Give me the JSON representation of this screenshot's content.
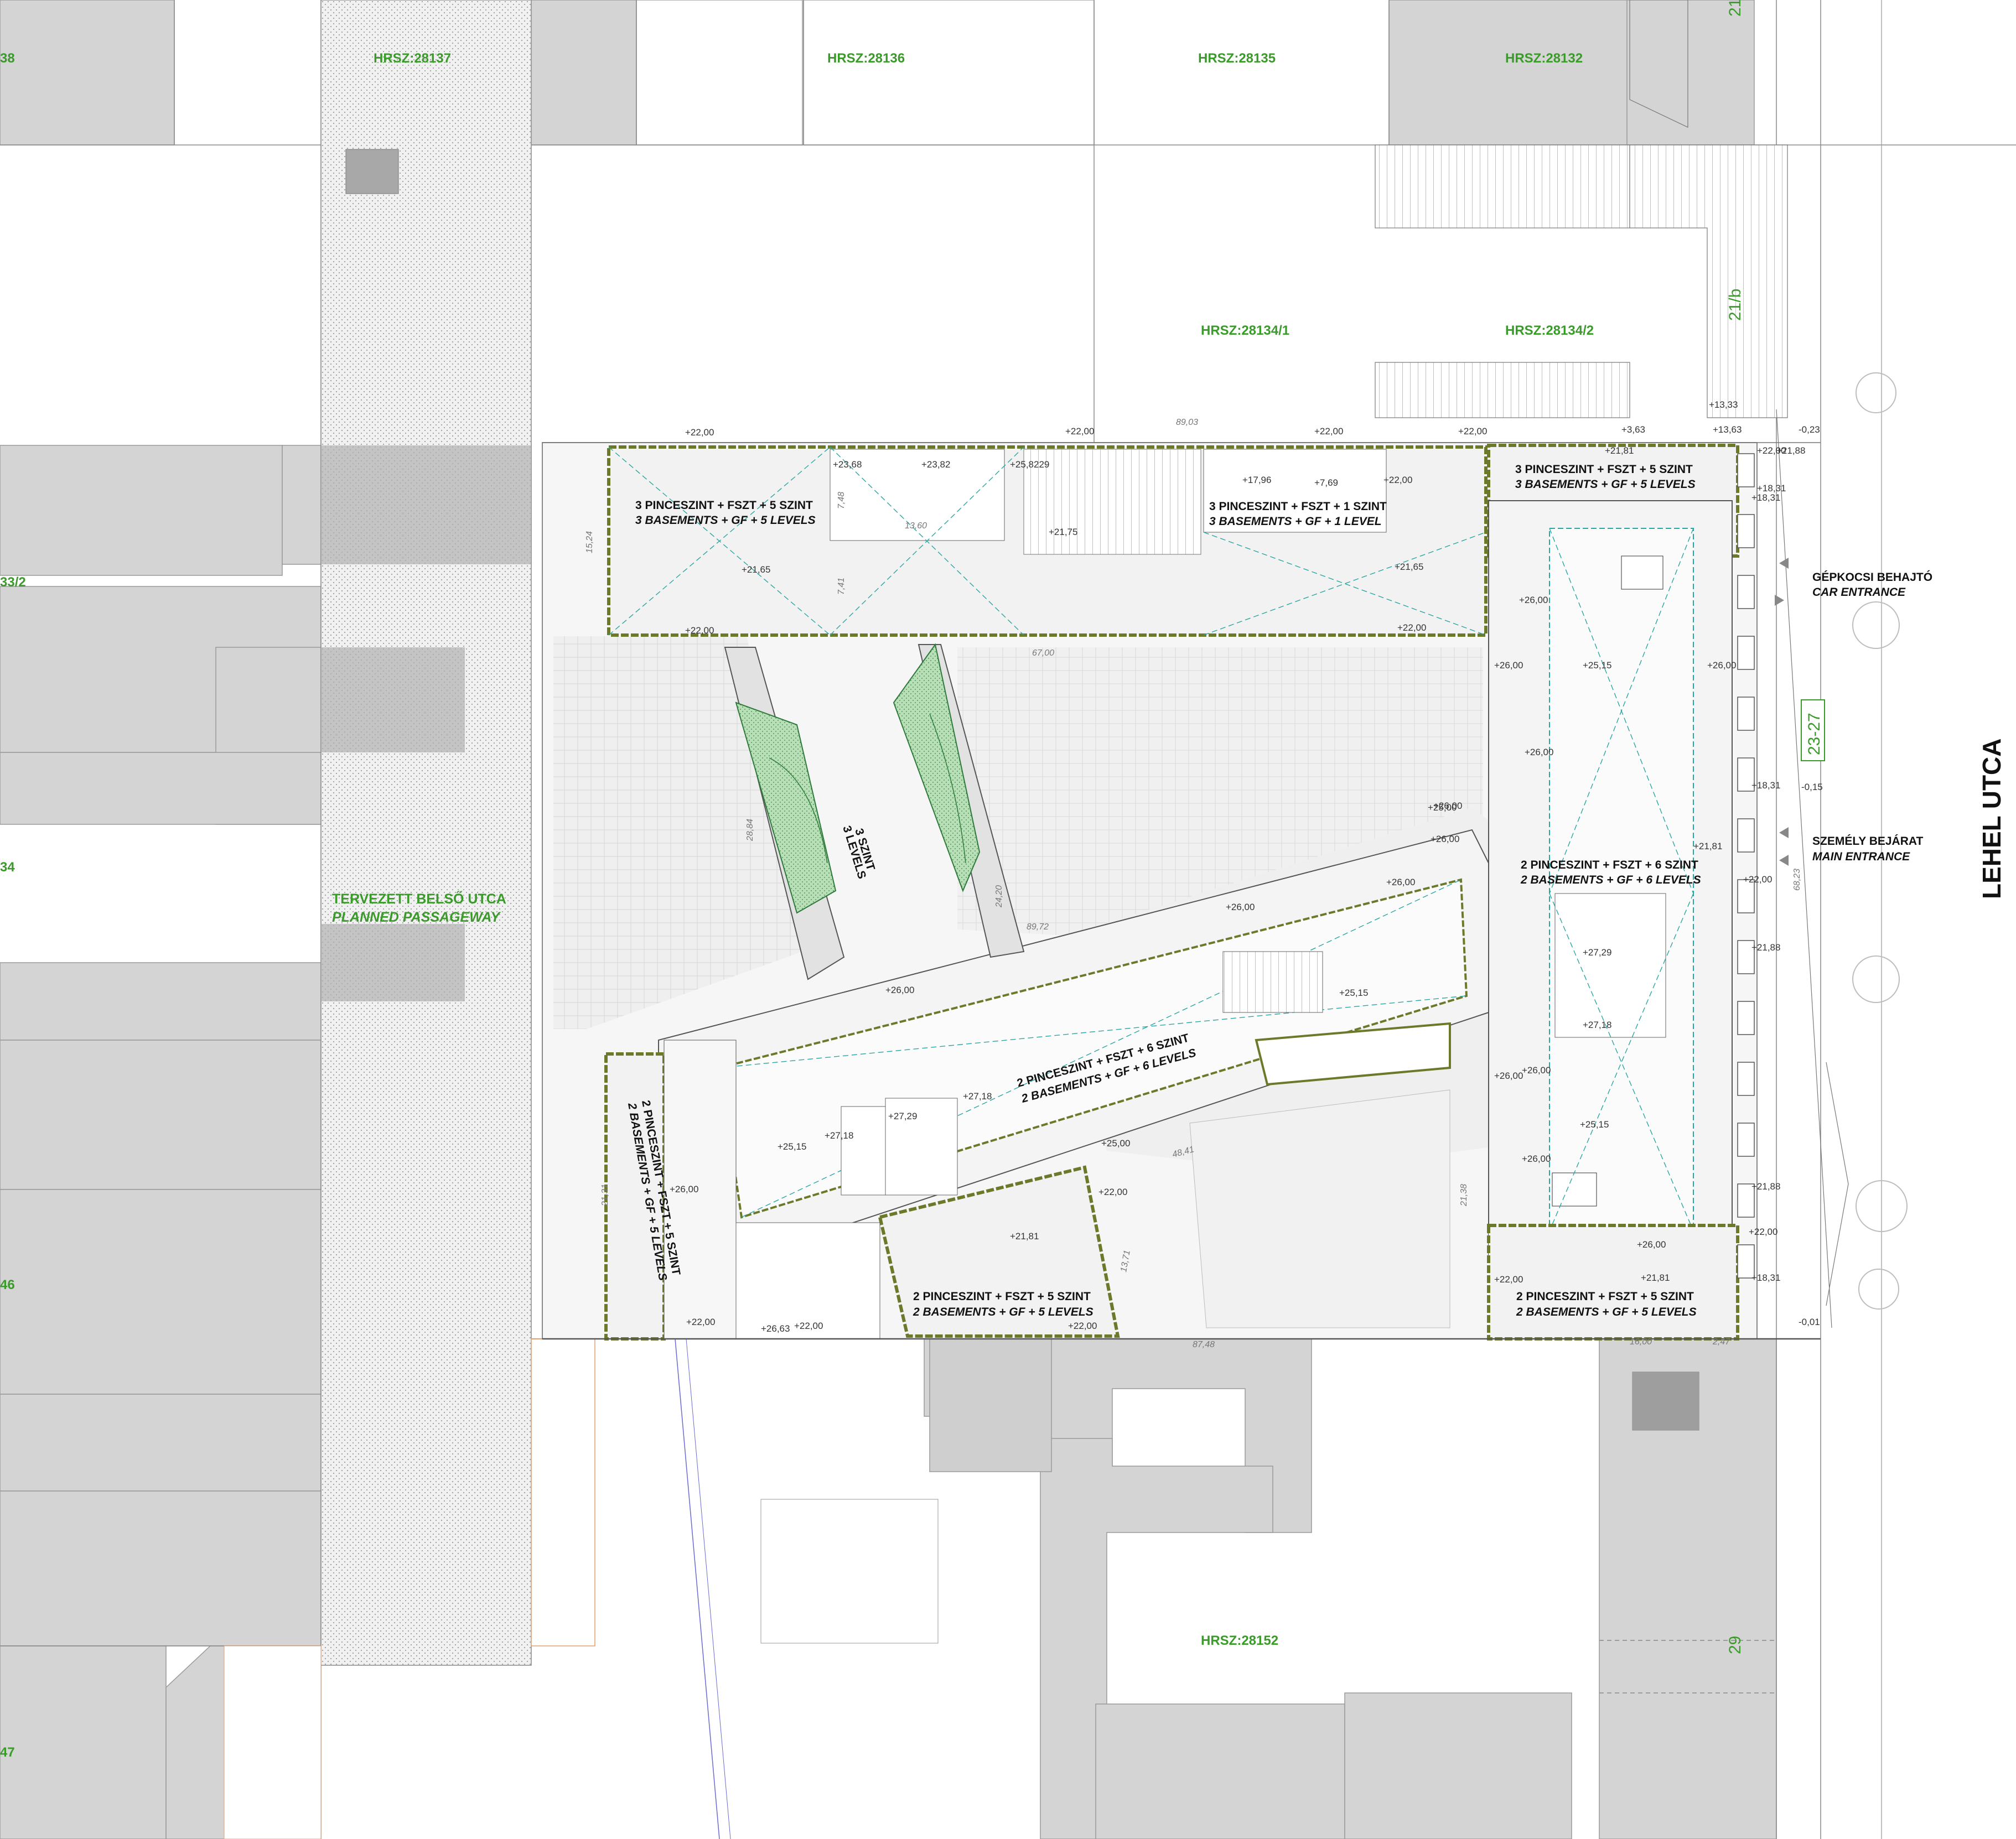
{
  "plots": [
    {
      "id": "hrsz-28137",
      "label": "HRSZ:28137"
    },
    {
      "id": "hrsz-28136",
      "label": "HRSZ:28136"
    },
    {
      "id": "hrsz-28135",
      "label": "HRSZ:28135"
    },
    {
      "id": "hrsz-28132",
      "label": "HRSZ:28132"
    },
    {
      "id": "hrsz-28134-1",
      "label": "HRSZ:28134/1"
    },
    {
      "id": "hrsz-28134-2",
      "label": "HRSZ:28134/2"
    },
    {
      "id": "hrsz-28152",
      "label": "HRSZ:28152"
    }
  ],
  "edge_plot_fragments": [
    "38",
    "33/2",
    "34",
    "46",
    "47"
  ],
  "house_numbers": {
    "n21b": "21/b",
    "n21": "21",
    "n23_27": "23-27",
    "n29": "29"
  },
  "street": {
    "name": "LEHEL UTCA"
  },
  "passageway": {
    "hu": "TERVEZETT BELSŐ UTCA",
    "en": "PLANNED PASSAGEWAY"
  },
  "entrances": {
    "car_hu": "GÉPKOCSI BEHAJTÓ",
    "car_en": "CAR ENTRANCE",
    "main_hu": "SZEMÉLY BEJÁRAT",
    "main_en": "MAIN ENTRANCE"
  },
  "buildings": {
    "nw": {
      "hu": "3 PINCESZINT + FSZT + 5 SZINT",
      "en": "3 BASEMENTS + GF + 5 LEVELS"
    },
    "n_mid": {
      "hu": "3 PINCESZINT + FSZT + 1 SZINT",
      "en": "3 BASEMENTS + GF + 1 LEVEL"
    },
    "ne": {
      "hu": "3 PINCESZINT + FSZT + 5 SZINT",
      "en": "3 BASEMENTS + GF + 5 LEVELS"
    },
    "pavilion": {
      "hu": "3 SZINT",
      "en": "3 LEVELS"
    },
    "east": {
      "hu": "2 PINCESZINT + FSZT + 6 SZINT",
      "en": "2 BASEMENTS + GF + 6 LEVELS"
    },
    "centre": {
      "hu": "2 PINCESZINT + FSZT + 6 SZINT",
      "en": "2 BASEMENTS + GF + 6 LEVELS"
    },
    "west": {
      "hu": "2 PINCESZINT + FSZT + 5 SZINT",
      "en": "2 BASEMENTS + GF + 5 LEVELS"
    },
    "south": {
      "hu": "2 PINCESZINT + FSZT + 5 SZINT",
      "en": "2 BASEMENTS + GF + 5 LEVELS"
    },
    "se": {
      "hu": "2 PINCESZINT + FSZT + 5 SZINT",
      "en": "2 BASEMENTS + GF + 5 LEVELS"
    }
  },
  "elevations": {
    "e01": "+22,00",
    "e02": "+22,00",
    "e03": "+22,00",
    "e04": "+22,00",
    "e05": "+23,68",
    "e06": "+23,82",
    "e07": "+25,8229",
    "e08": "+21,75",
    "e09": "+17,96",
    "e10": "+7,69",
    "e11": "+22,00",
    "e12": "+21,65",
    "e13": "+21,65",
    "e14": "+22,00",
    "e15": "+22,00",
    "e16": "+21,81",
    "e17": "+22,00",
    "e18": "+21,88",
    "e19": "+13,33",
    "e20": "+13,63",
    "e21": "+3,63",
    "e22": "-0,23",
    "e23": "+18,31",
    "e24": "+26,00",
    "e25": "+25,15",
    "e26": "+26,00",
    "e27": "+26,00",
    "e28": "+26,00",
    "e29": "+26,00",
    "e30": "+18,31",
    "e31": "-0,15",
    "e32": "+21,81",
    "e33": "+22,00",
    "e34": "+21,88",
    "e35": "+26,00",
    "e36": "+27,29",
    "e37": "+27,18",
    "e38": "+25,15",
    "e39": "+26,00",
    "e40": "+26,00",
    "e41": "+25,15",
    "e42": "+26,00",
    "e43": "+25,15",
    "e44": "+27,18",
    "e45": "+27,29",
    "e46": "+27,18",
    "e47": "+25,00",
    "e48": "+22,00",
    "e49": "+26,00",
    "e50": "+22,00",
    "e51": "+26,63",
    "e52": "+22,00",
    "e53": "+21,81",
    "e54": "+22,00",
    "e55": "+26,00",
    "e56": "+21,81",
    "e57": "+22,00",
    "e58": "+21,88",
    "e59": "+22,00",
    "e60": "+18,31",
    "e61": "-0,01",
    "e62": "+26,00",
    "e63": "+26,00",
    "e64": "+25,00",
    "e65": "+26,00",
    "e66": "+18,31"
  },
  "dimensions": {
    "d01": "89,03",
    "d02": "67,00",
    "d03": "13,60",
    "d04": "87,48",
    "d05": "68,23",
    "d06": "48,41",
    "d07": "21,38",
    "d08": "21,31",
    "d09": "13,71",
    "d10": "89,72",
    "d11": "24,20",
    "d12": "28,84",
    "d13": "15,24",
    "d14": "7,48",
    "d15": "7,41",
    "d16": "16,00",
    "d17": "2,47"
  },
  "colors": {
    "neighbor_building": "#d4d4d4",
    "neighbor_dark": "#a8a8a8",
    "site_outline": "#6b7a2a",
    "green_accent": "#3a9a2a",
    "green_roof": "#b9dfb8",
    "roof_diagonal": "#2aa6a0",
    "paving": "#e6e6e6"
  }
}
